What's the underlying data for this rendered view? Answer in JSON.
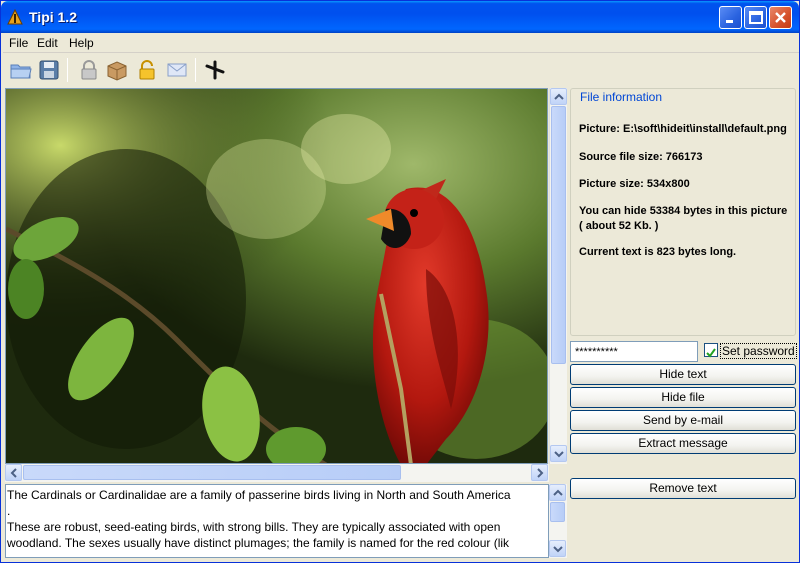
{
  "window": {
    "title": "Tipi 1.2"
  },
  "menu": [
    "File",
    "Edit",
    "Help"
  ],
  "toolbar": {
    "icons": [
      "open-icon",
      "save-icon",
      "lock-icon",
      "box-icon",
      "unlock-icon",
      "mail-icon",
      "pin-icon"
    ]
  },
  "text_panel": {
    "lines": [
      "The Cardinals or Cardinalidae are a family of passerine birds living in North and South America",
      ".",
      "These are robust, seed-eating birds, with strong bills. They are typically associated with open",
      "woodland. The sexes usually have distinct plumages; the family is named for the red colour (lik"
    ]
  },
  "file_info": {
    "title": "File information",
    "picture": "Picture: E:\\soft\\hideit\\install\\default.png",
    "source_size": "Source file size: 766173",
    "picture_size": "Picture size: 534x800",
    "capacity": "You can hide 53384 bytes in this picture ( about 52 Kb. )",
    "current_text": "Current text is 823 bytes long."
  },
  "password": {
    "value": "**********",
    "checkbox_label": "Set password",
    "checked": true
  },
  "buttons": {
    "hide_text": "Hide text",
    "hide_file": "Hide file",
    "send_email": "Send by e-mail",
    "extract": "Extract message",
    "remove_text": "Remove text"
  }
}
